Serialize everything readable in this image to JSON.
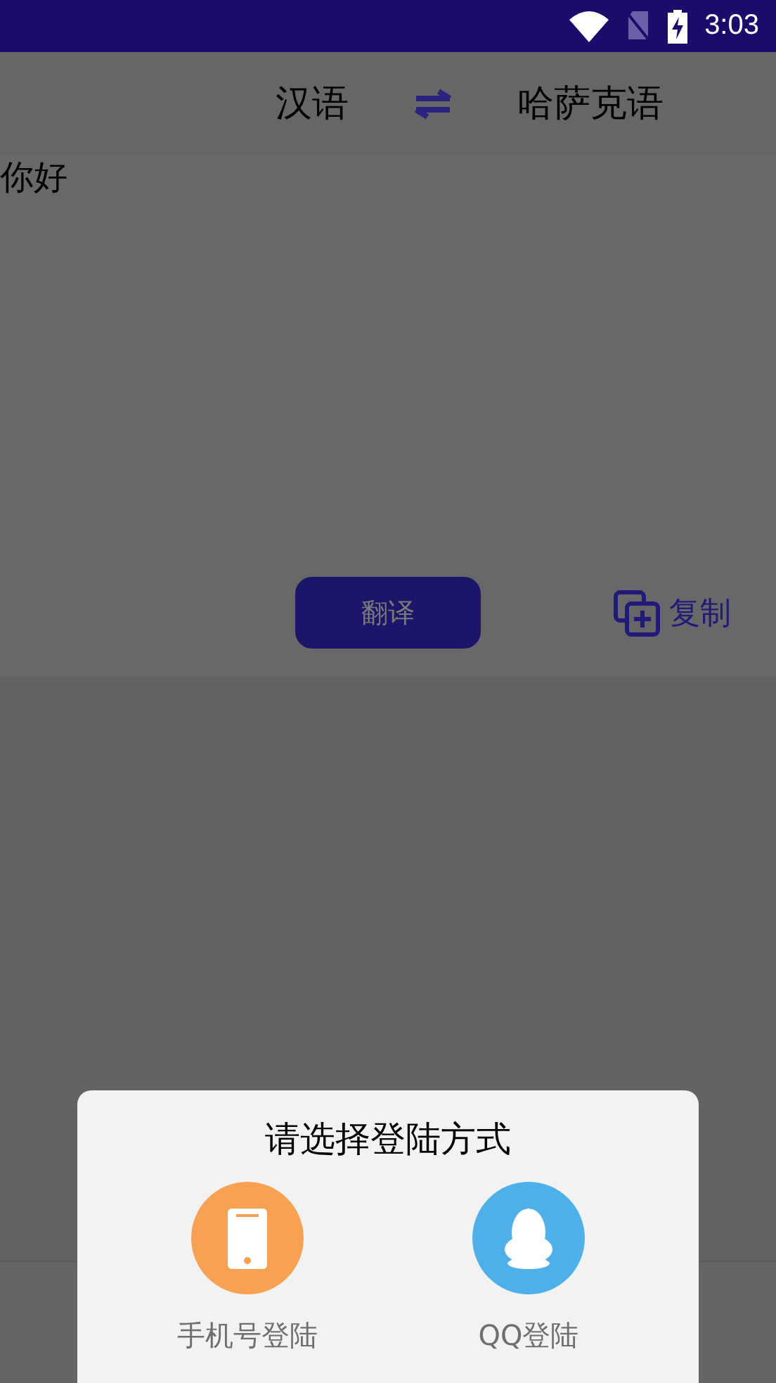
{
  "status_bar": {
    "time": "3:03"
  },
  "language_bar": {
    "source": "汉语",
    "target": "哈萨克语"
  },
  "input": {
    "value": "你好"
  },
  "actions": {
    "translate": "翻译",
    "copy": "复制"
  },
  "dialog": {
    "title": "请选择登陆方式",
    "options": [
      {
        "kind": "phone",
        "label": "手机号登陆",
        "color": "#f9a153"
      },
      {
        "kind": "qq",
        "label": "QQ登陆",
        "color": "#4fb0e9"
      }
    ]
  }
}
